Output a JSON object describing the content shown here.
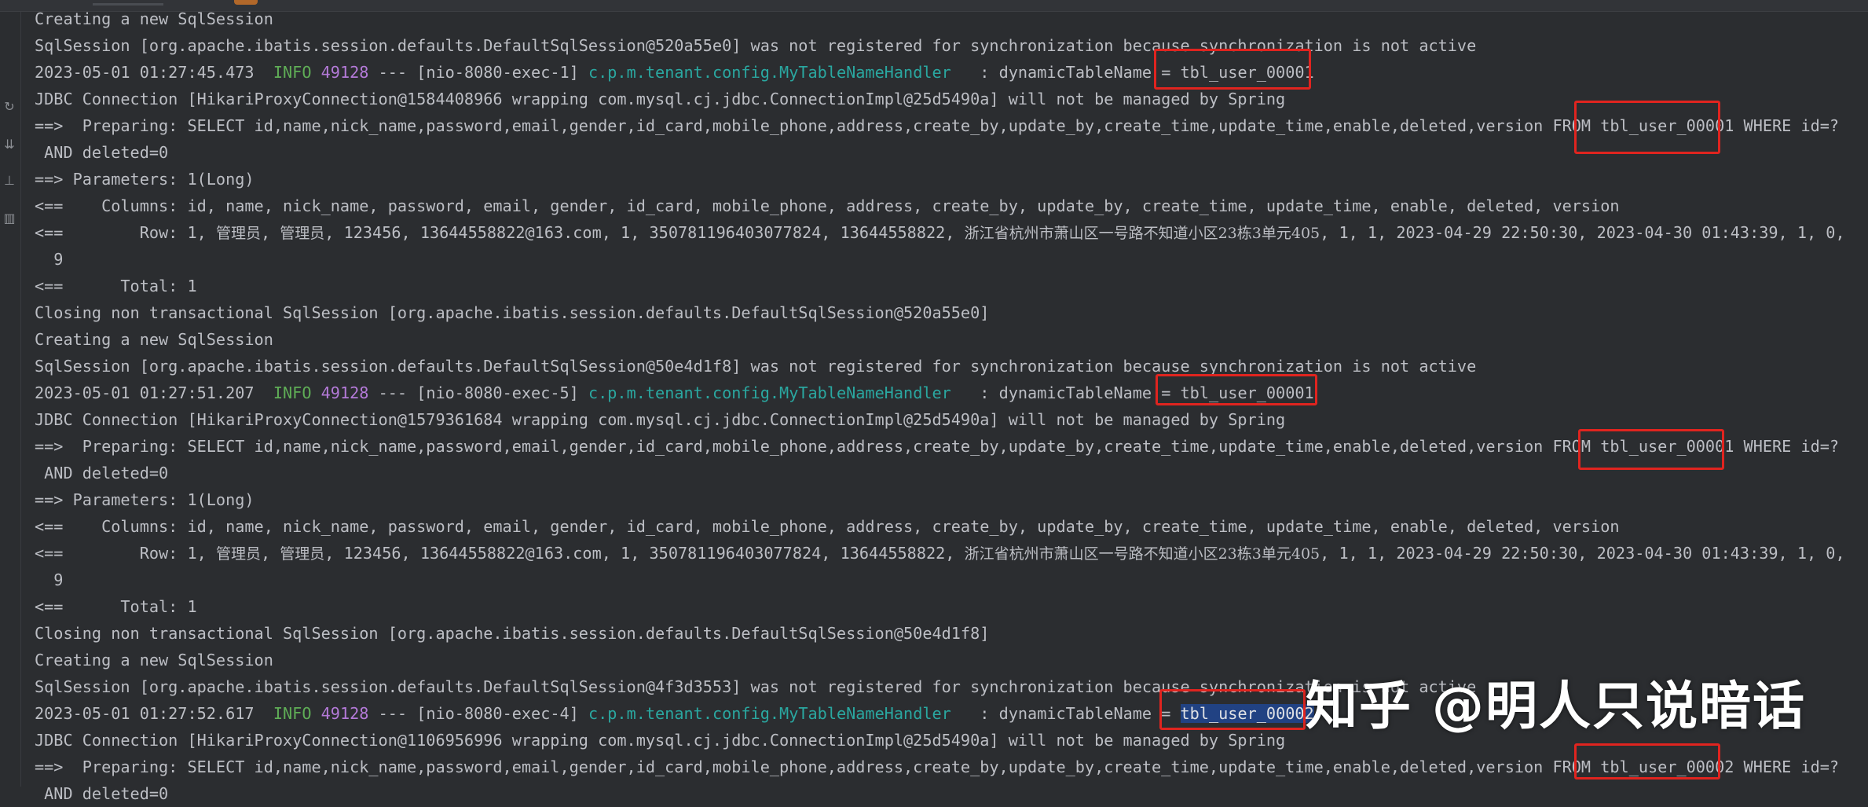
{
  "watermark": "知乎 @明人只说暗话",
  "gutter_icons": [
    "rerun-icon",
    "scroll-down-icon",
    "pin-icon",
    "trash-icon"
  ],
  "colors": {
    "background": "#2b2d30",
    "text": "#bcbec4",
    "info_level": "#5fad56",
    "pid": "#b47ad8",
    "logger": "#2aa7a0",
    "highlight_box": "#e0241f",
    "selection": "#214283"
  },
  "console": {
    "l01": "Creating a new SqlSession",
    "l02": "SqlSession [org.apache.ibatis.session.defaults.DefaultSqlSession@520a55e0] was not registered for synchronization because synchronization is not active",
    "l03": {
      "ts": "2023-05-01 01:27:45.473  ",
      "level": "INFO",
      "pid": "49128",
      "thread": " --- [nio-8080-exec-1] ",
      "logger": "c.p.m.tenant.config.MyTableNameHandler",
      "msg": "   : dynamicTableName = tbl_user_00001"
    },
    "l04": "JDBC Connection [HikariProxyConnection@1584408966 wrapping com.mysql.cj.jdbc.ConnectionImpl@25d5490a] will not be managed by Spring",
    "l05": "==>  Preparing: SELECT id,name,nick_name,password,email,gender,id_card,mobile_phone,address,create_by,update_by,create_time,update_time,enable,deleted,version FROM tbl_user_00001 WHERE id=?",
    "l06": " AND deleted=0",
    "l07": "==> Parameters: 1(Long)",
    "l08": "<==    Columns: id, name, nick_name, password, email, gender, id_card, mobile_phone, address, create_by, update_by, create_time, update_time, enable, deleted, version",
    "l09": {
      "pre": "<==        Row: 1, ",
      "n1": "管理员",
      "sep1": ", ",
      "n2": "管理员",
      "mid": ", 123456, 13644558822@163.com, 1, 350781196403077824, 13644558822, ",
      "addr": "浙江省杭州市萧山区一号路不知道小区23栋3单元405",
      "post": ", 1, 1, 2023-04-29 22:50:30, 2023-04-30 01:43:39, 1, 0,"
    },
    "l10": "  9",
    "l11": "<==      Total: 1",
    "l12": "Closing non transactional SqlSession [org.apache.ibatis.session.defaults.DefaultSqlSession@520a55e0]",
    "l13": "Creating a new SqlSession",
    "l14": "SqlSession [org.apache.ibatis.session.defaults.DefaultSqlSession@50e4d1f8] was not registered for synchronization because synchronization is not active",
    "l15": {
      "ts": "2023-05-01 01:27:51.207  ",
      "level": "INFO",
      "pid": "49128",
      "thread": " --- [nio-8080-exec-5] ",
      "logger": "c.p.m.tenant.config.MyTableNameHandler",
      "msg": "   : dynamicTableName = tbl_user_00001"
    },
    "l16": "JDBC Connection [HikariProxyConnection@1579361684 wrapping com.mysql.cj.jdbc.ConnectionImpl@25d5490a] will not be managed by Spring",
    "l17": "==>  Preparing: SELECT id,name,nick_name,password,email,gender,id_card,mobile_phone,address,create_by,update_by,create_time,update_time,enable,deleted,version FROM tbl_user_00001 WHERE id=?",
    "l18": " AND deleted=0",
    "l19": "==> Parameters: 1(Long)",
    "l20": "<==    Columns: id, name, nick_name, password, email, gender, id_card, mobile_phone, address, create_by, update_by, create_time, update_time, enable, deleted, version",
    "l21": {
      "pre": "<==        Row: 1, ",
      "n1": "管理员",
      "sep1": ", ",
      "n2": "管理员",
      "mid": ", 123456, 13644558822@163.com, 1, 350781196403077824, 13644558822, ",
      "addr": "浙江省杭州市萧山区一号路不知道小区23栋3单元405",
      "post": ", 1, 1, 2023-04-29 22:50:30, 2023-04-30 01:43:39, 1, 0,"
    },
    "l22": "  9",
    "l23": "<==      Total: 1",
    "l24": "Closing non transactional SqlSession [org.apache.ibatis.session.defaults.DefaultSqlSession@50e4d1f8]",
    "l25": "Creating a new SqlSession",
    "l26": "SqlSession [org.apache.ibatis.session.defaults.DefaultSqlSession@4f3d3553] was not registered for synchronization because synchronization is not active",
    "l27": {
      "ts": "2023-05-01 01:27:52.617  ",
      "level": "INFO",
      "pid": "49128",
      "thread": " --- [nio-8080-exec-4] ",
      "logger": "c.p.m.tenant.config.MyTableNameHandler",
      "msg_pre": "   : dynamicTableName = ",
      "msg_sel": "tbl_user_00002"
    },
    "l28": "JDBC Connection [HikariProxyConnection@1106956996 wrapping com.mysql.cj.jdbc.ConnectionImpl@25d5490a] will not be managed by Spring",
    "l29": "==>  Preparing: SELECT id,name,nick_name,password,email,gender,id_card,mobile_phone,address,create_by,update_by,create_time,update_time,enable,deleted,version FROM tbl_user_00002 WHERE id=?",
    "l30": " AND deleted=0"
  }
}
